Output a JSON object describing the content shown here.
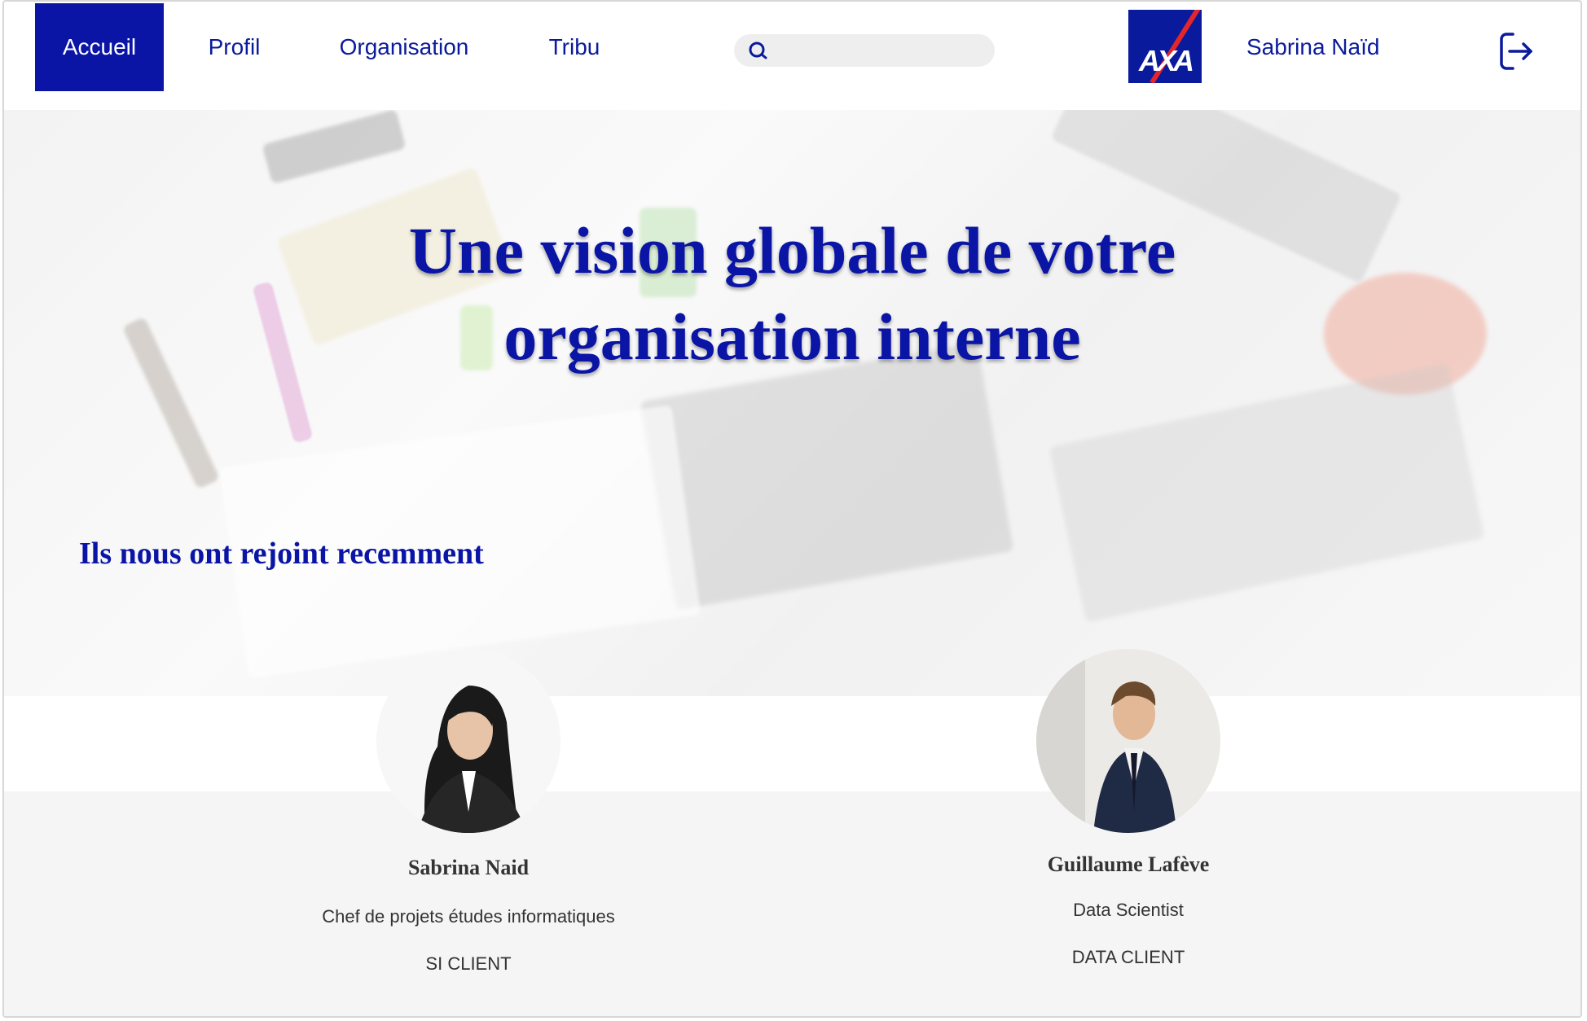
{
  "nav": {
    "tabs": [
      {
        "label": "Accueil"
      },
      {
        "label": "Profil"
      },
      {
        "label": "Organisation"
      },
      {
        "label": "Tribu"
      }
    ],
    "search_placeholder": "",
    "brand": "AXA",
    "user_name": "Sabrina Naïd",
    "accent_color": "#0a14a5"
  },
  "hero": {
    "title_line1": "Une vision globale de votre",
    "title_line2": "organisation interne",
    "recent_title": "Ils nous ont rejoint recemment"
  },
  "recent": [
    {
      "name": "Sabrina Naid",
      "role": "Chef de projets études informatiques",
      "dept": "SI CLIENT"
    },
    {
      "name": "Guillaume  Lafève",
      "role": "Data Scientist",
      "dept": "DATA CLIENT"
    }
  ]
}
